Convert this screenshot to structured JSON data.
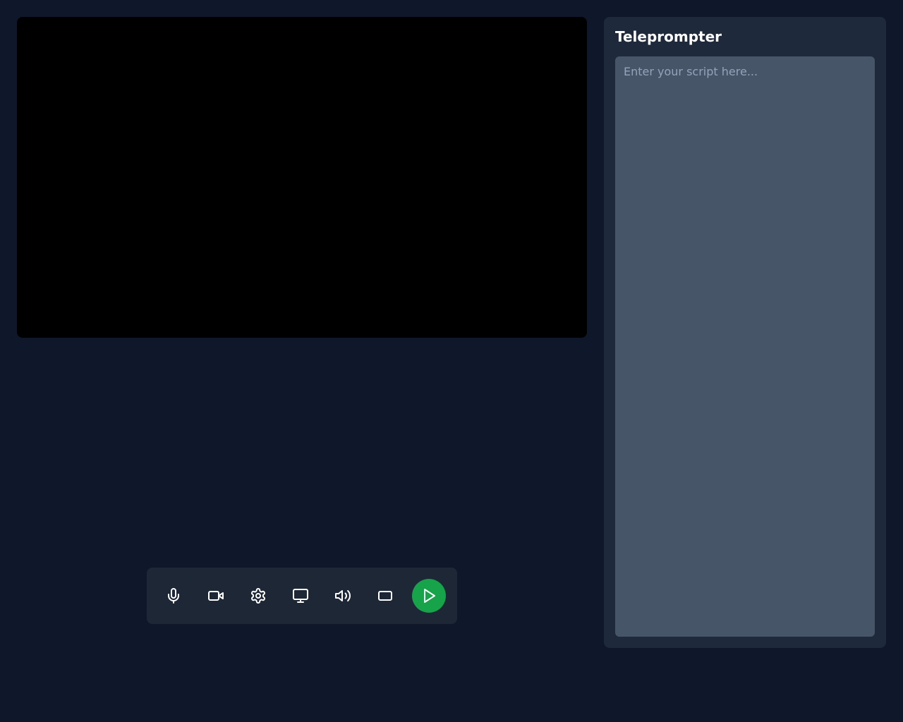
{
  "teleprompter": {
    "title": "Teleprompter",
    "placeholder": "Enter your script here...",
    "value": ""
  },
  "toolbar": {
    "mic": "Microphone",
    "video": "Video",
    "settings": "Settings",
    "monitor": "Monitor",
    "volume": "Volume",
    "teleprompter_toggle": "Toggle Teleprompter",
    "play": "Start Recording"
  }
}
